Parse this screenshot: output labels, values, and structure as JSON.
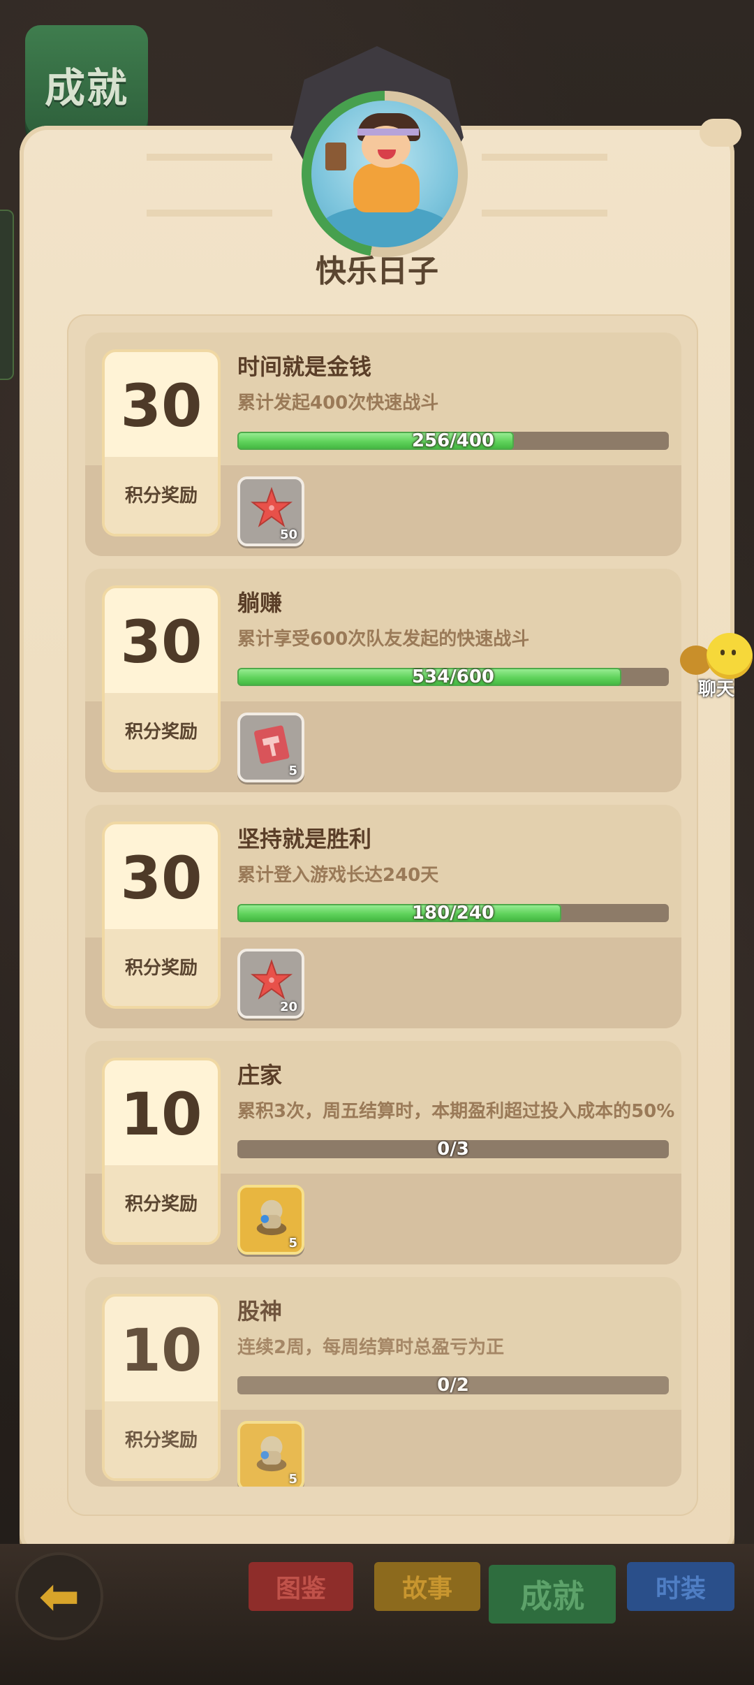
{
  "header": {
    "banner_label": "成就",
    "title": "快乐日子"
  },
  "achievements": [
    {
      "points": "30",
      "reward_label": "积分奖励",
      "title": "时间就是金钱",
      "desc": "累计发起400次快速战斗",
      "progress_text": "256/400",
      "progress": 0.64,
      "item_icon": "starfish-icon",
      "item_count": "50"
    },
    {
      "points": "30",
      "reward_label": "积分奖励",
      "title": "躺赚",
      "desc": "累计享受600次队友发起的快速战斗",
      "progress_text": "534/600",
      "progress": 0.89,
      "item_icon": "hammer-ticket-icon",
      "item_count": "5"
    },
    {
      "points": "30",
      "reward_label": "积分奖励",
      "title": "坚持就是胜利",
      "desc": "累计登入游戏长达240天",
      "progress_text": "180/240",
      "progress": 0.75,
      "item_icon": "starfish-icon",
      "item_count": "20"
    },
    {
      "points": "10",
      "reward_label": "积分奖励",
      "title": "庄家",
      "desc": "累积3次，周五结算时，本期盈利超过投入成本的50%",
      "progress_text": "0/3",
      "progress": 0,
      "item_icon": "golden-idol-icon",
      "item_count": "5"
    },
    {
      "points": "10",
      "reward_label": "积分奖励",
      "title": "股神",
      "desc": "连续2周，每周结算时总盈亏为正",
      "progress_text": "0/2",
      "progress": 0,
      "item_icon": "golden-idol-icon",
      "item_count": "5"
    }
  ],
  "chat": {
    "label": "聊天"
  },
  "tabs": {
    "t1": "图鉴",
    "t2": "故事",
    "t3": "成就",
    "t4": "时装"
  },
  "colors": {
    "progress_green": "#5fd25b",
    "bar_track": "#8d7b68",
    "parchment": "#f2e3c9"
  }
}
